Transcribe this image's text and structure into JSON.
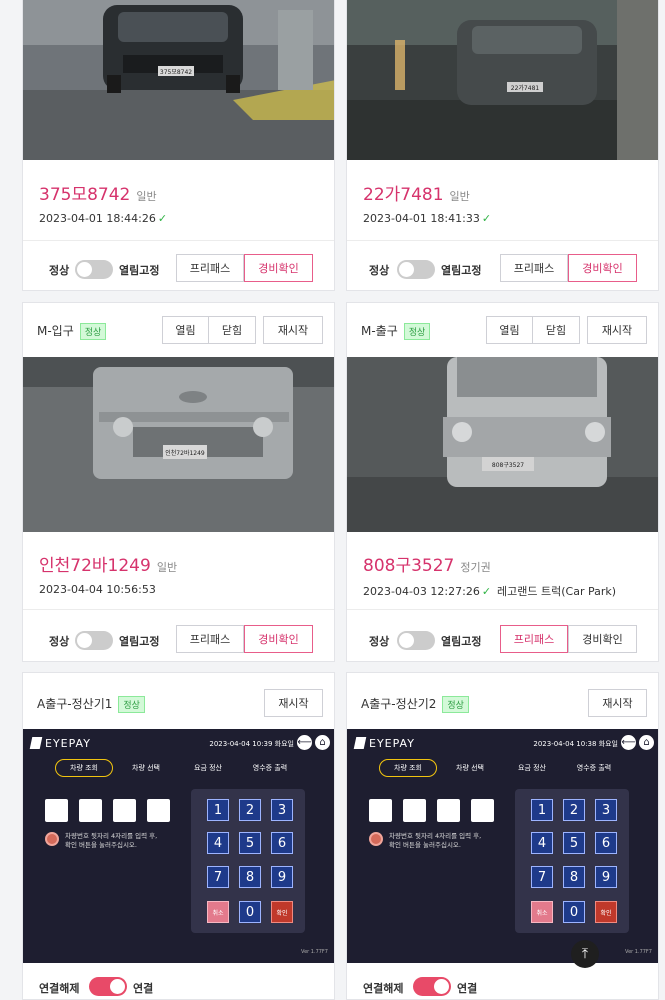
{
  "top_left": {
    "plate": "375모8742",
    "kind": "일반",
    "timestamp": "2023-04-01 18:44:26",
    "check": "✓",
    "cam_plate": "375모8742"
  },
  "top_right": {
    "plate": "22가7481",
    "kind": "일반",
    "timestamp": "2023-04-01 18:41:33",
    "check": "✓",
    "cam_plate": "22가7481"
  },
  "controls": {
    "normal": "정상",
    "fixed_open": "열림고정",
    "freepass": "프리패스",
    "guard_check": "경비확인"
  },
  "mid_left": {
    "title": "M-입구",
    "status": "정상",
    "open": "열림",
    "close": "닫힘",
    "restart": "재시작",
    "plate": "인천72바1249",
    "kind": "일반",
    "timestamp": "2023-04-04 10:56:53",
    "cam_plate": "인천72바1249"
  },
  "mid_right": {
    "title": "M-출구",
    "status": "정상",
    "open": "열림",
    "close": "닫힘",
    "restart": "재시작",
    "plate": "808구3527",
    "kind": "정기권",
    "timestamp": "2023-04-03 12:27:26",
    "check": "✓",
    "note": "레고랜드 트럭(Car Park)",
    "cam_plate": "808구3527"
  },
  "pay_left": {
    "title": "A출구-정산기1",
    "status": "정상",
    "restart": "재시작",
    "date": "2023-04-04 10:39 화요일"
  },
  "pay_right": {
    "title": "A출구-정산기2",
    "status": "정상",
    "restart": "재시작",
    "date": "2023-04-04 10:38 화요일"
  },
  "eyepay": {
    "logo": "EYEPAY",
    "tabs": [
      "차량 조회",
      "차량 선택",
      "요금 정산",
      "영수증 출력"
    ],
    "info_line1": "차량번호 뒷자리 4자리를 입력 후,",
    "info_line2": "확인 버튼을 눌러주십시오.",
    "keys": [
      "1",
      "2",
      "3",
      "4",
      "5",
      "6",
      "7",
      "8",
      "9"
    ],
    "zero": "0",
    "cancel": "취소",
    "ok": "확인",
    "version": "Ver 1.77F7"
  },
  "connection": {
    "disconnect": "연결해제",
    "connect": "연결"
  },
  "fab_glyph": "⤒",
  "colors": {
    "accent": "#d6336c",
    "ok_green": "#2fb344",
    "pay_bg": "#1e1e30",
    "switch_on": "#e84a68"
  }
}
